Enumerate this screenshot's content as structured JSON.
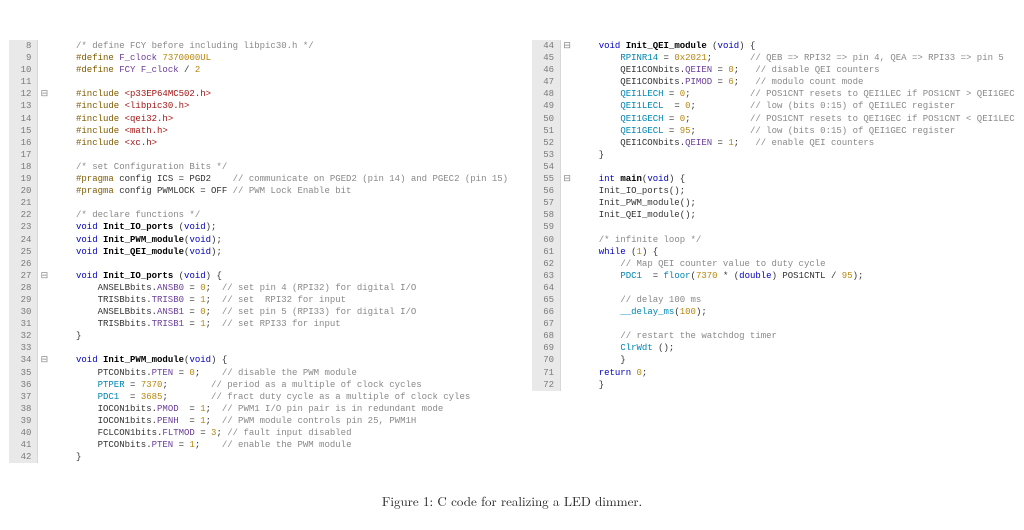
{
  "caption": "Figure 1: C code for realizing a LED dimmer.",
  "left": [
    {
      "n": 8,
      "fold": "",
      "tokens": [
        [
          "    ",
          ""
        ],
        [
          "/* define FCY before including libpic30.h */",
          "cm"
        ]
      ]
    },
    {
      "n": 9,
      "fold": "",
      "tokens": [
        [
          "    ",
          ""
        ],
        [
          "#define",
          "pp"
        ],
        [
          " ",
          ""
        ],
        [
          "F_clock",
          "mac"
        ],
        [
          " ",
          ""
        ],
        [
          "7370000UL",
          "num"
        ]
      ]
    },
    {
      "n": 10,
      "fold": "",
      "tokens": [
        [
          "    ",
          ""
        ],
        [
          "#define",
          "pp"
        ],
        [
          " ",
          ""
        ],
        [
          "FCY",
          "mac"
        ],
        [
          " ",
          ""
        ],
        [
          "F_clock",
          "mac"
        ],
        [
          " / ",
          ""
        ],
        [
          "2",
          "num"
        ]
      ]
    },
    {
      "n": 11,
      "fold": "",
      "tokens": []
    },
    {
      "n": 12,
      "fold": "⊟",
      "tokens": [
        [
          "    ",
          ""
        ],
        [
          "#include",
          "pp"
        ],
        [
          " ",
          ""
        ],
        [
          "<p33EP64MC502.h>",
          "str"
        ]
      ]
    },
    {
      "n": 13,
      "fold": "",
      "tokens": [
        [
          "    ",
          ""
        ],
        [
          "#include",
          "pp"
        ],
        [
          " ",
          ""
        ],
        [
          "<libpic30.h>",
          "str"
        ]
      ]
    },
    {
      "n": 14,
      "fold": "",
      "tokens": [
        [
          "    ",
          ""
        ],
        [
          "#include",
          "pp"
        ],
        [
          " ",
          ""
        ],
        [
          "<qei32.h>",
          "str"
        ]
      ]
    },
    {
      "n": 15,
      "fold": "",
      "tokens": [
        [
          "    ",
          ""
        ],
        [
          "#include",
          "pp"
        ],
        [
          " ",
          ""
        ],
        [
          "<math.h>",
          "str"
        ]
      ]
    },
    {
      "n": 16,
      "fold": "",
      "tokens": [
        [
          "    ",
          ""
        ],
        [
          "#include",
          "pp"
        ],
        [
          " ",
          ""
        ],
        [
          "<xc.h>",
          "str"
        ]
      ]
    },
    {
      "n": 17,
      "fold": "",
      "tokens": []
    },
    {
      "n": 18,
      "fold": "",
      "tokens": [
        [
          "    ",
          ""
        ],
        [
          "/* set Configuration Bits */",
          "cm"
        ]
      ]
    },
    {
      "n": 19,
      "fold": "",
      "tokens": [
        [
          "    ",
          ""
        ],
        [
          "#pragma",
          "pp"
        ],
        [
          " config ICS = PGD2    ",
          ""
        ],
        [
          "// communicate on PGED2 (pin 14) and PGEC2 (pin 15)",
          "cm"
        ]
      ]
    },
    {
      "n": 20,
      "fold": "",
      "tokens": [
        [
          "    ",
          ""
        ],
        [
          "#pragma",
          "pp"
        ],
        [
          " config PWMLOCK = OFF ",
          ""
        ],
        [
          "// PWM Lock Enable bit",
          "cm"
        ]
      ]
    },
    {
      "n": 21,
      "fold": "",
      "tokens": []
    },
    {
      "n": 22,
      "fold": "",
      "tokens": [
        [
          "    ",
          ""
        ],
        [
          "/* declare functions */",
          "cm"
        ]
      ]
    },
    {
      "n": 23,
      "fold": "",
      "tokens": [
        [
          "    ",
          ""
        ],
        [
          "void",
          "kw"
        ],
        [
          " ",
          ""
        ],
        [
          "Init_IO_ports",
          "fn"
        ],
        [
          " (",
          ""
        ],
        [
          "void",
          "kw"
        ],
        [
          ");",
          ""
        ]
      ]
    },
    {
      "n": 24,
      "fold": "",
      "tokens": [
        [
          "    ",
          ""
        ],
        [
          "void",
          "kw"
        ],
        [
          " ",
          ""
        ],
        [
          "Init_PWM_module",
          "fn"
        ],
        [
          "(",
          ""
        ],
        [
          "void",
          "kw"
        ],
        [
          ");",
          ""
        ]
      ]
    },
    {
      "n": 25,
      "fold": "",
      "tokens": [
        [
          "    ",
          ""
        ],
        [
          "void",
          "kw"
        ],
        [
          " ",
          ""
        ],
        [
          "Init_QEI_module",
          "fn"
        ],
        [
          "(",
          ""
        ],
        [
          "void",
          "kw"
        ],
        [
          ");",
          ""
        ]
      ]
    },
    {
      "n": 26,
      "fold": "",
      "tokens": []
    },
    {
      "n": 27,
      "fold": "⊟",
      "tokens": [
        [
          "    ",
          ""
        ],
        [
          "void",
          "kw"
        ],
        [
          " ",
          ""
        ],
        [
          "Init_IO_ports",
          "fn"
        ],
        [
          " (",
          ""
        ],
        [
          "void",
          "kw"
        ],
        [
          ") {",
          ""
        ]
      ]
    },
    {
      "n": 28,
      "fold": "",
      "tokens": [
        [
          "        ANSELBbits.",
          ""
        ],
        [
          "ANSB0",
          "fld"
        ],
        [
          " = ",
          ""
        ],
        [
          "0",
          "num"
        ],
        [
          ";  ",
          ""
        ],
        [
          "// set pin 4 (RPI32) for digital I/O",
          "cm"
        ]
      ]
    },
    {
      "n": 29,
      "fold": "",
      "tokens": [
        [
          "        TRISBbits.",
          ""
        ],
        [
          "TRISB0",
          "fld"
        ],
        [
          " = ",
          ""
        ],
        [
          "1",
          "num"
        ],
        [
          ";  ",
          ""
        ],
        [
          "// set  RPI32 for input",
          "cm"
        ]
      ]
    },
    {
      "n": 30,
      "fold": "",
      "tokens": [
        [
          "        ANSELBbits.",
          ""
        ],
        [
          "ANSB1",
          "fld"
        ],
        [
          " = ",
          ""
        ],
        [
          "0",
          "num"
        ],
        [
          ";  ",
          ""
        ],
        [
          "// set pin 5 (RPI33) for digital I/O",
          "cm"
        ]
      ]
    },
    {
      "n": 31,
      "fold": "",
      "tokens": [
        [
          "        TRISBbits.",
          ""
        ],
        [
          "TRISB1",
          "fld"
        ],
        [
          " = ",
          ""
        ],
        [
          "1",
          "num"
        ],
        [
          ";  ",
          ""
        ],
        [
          "// set RPI33 for input",
          "cm"
        ]
      ]
    },
    {
      "n": 32,
      "fold": "",
      "tokens": [
        [
          "    }",
          ""
        ]
      ]
    },
    {
      "n": 33,
      "fold": "",
      "tokens": []
    },
    {
      "n": 34,
      "fold": "⊟",
      "tokens": [
        [
          "    ",
          ""
        ],
        [
          "void",
          "kw"
        ],
        [
          " ",
          ""
        ],
        [
          "Init_PWM_module",
          "fn"
        ],
        [
          "(",
          ""
        ],
        [
          "void",
          "kw"
        ],
        [
          ") {",
          ""
        ]
      ]
    },
    {
      "n": 35,
      "fold": "",
      "tokens": [
        [
          "        PTCONbits.",
          ""
        ],
        [
          "PTEN",
          "fld"
        ],
        [
          " = ",
          ""
        ],
        [
          "0",
          "num"
        ],
        [
          ";    ",
          ""
        ],
        [
          "// disable the PWM module",
          "cm"
        ]
      ]
    },
    {
      "n": 36,
      "fold": "",
      "tokens": [
        [
          "        ",
          ""
        ],
        [
          "PTPER",
          "ref"
        ],
        [
          " = ",
          ""
        ],
        [
          "7370",
          "num"
        ],
        [
          ";        ",
          ""
        ],
        [
          "// period as a multiple of clock cycles",
          "cm"
        ]
      ]
    },
    {
      "n": 37,
      "fold": "",
      "tokens": [
        [
          "        ",
          ""
        ],
        [
          "PDC1",
          "ref"
        ],
        [
          "  = ",
          ""
        ],
        [
          "3685",
          "num"
        ],
        [
          ";        ",
          ""
        ],
        [
          "// fract duty cycle as a multiple of clock cyles",
          "cm"
        ]
      ]
    },
    {
      "n": 38,
      "fold": "",
      "tokens": [
        [
          "        IOCON1bits.",
          ""
        ],
        [
          "PMOD",
          "fld"
        ],
        [
          "  = ",
          ""
        ],
        [
          "1",
          "num"
        ],
        [
          ";  ",
          ""
        ],
        [
          "// PWM1 I/O pin pair is in redundant mode",
          "cm"
        ]
      ]
    },
    {
      "n": 39,
      "fold": "",
      "tokens": [
        [
          "        IOCON1bits.",
          ""
        ],
        [
          "PENH",
          "fld"
        ],
        [
          "  = ",
          ""
        ],
        [
          "1",
          "num"
        ],
        [
          ";  ",
          ""
        ],
        [
          "// PWM module controls pin 25, PWM1H",
          "cm"
        ]
      ]
    },
    {
      "n": 40,
      "fold": "",
      "tokens": [
        [
          "        FCLCON1bits.",
          ""
        ],
        [
          "FLTMOD",
          "fld"
        ],
        [
          " = ",
          ""
        ],
        [
          "3",
          "num"
        ],
        [
          "; ",
          ""
        ],
        [
          "// fault input disabled",
          "cm"
        ]
      ]
    },
    {
      "n": 41,
      "fold": "",
      "tokens": [
        [
          "        PTCONbits.",
          ""
        ],
        [
          "PTEN",
          "fld"
        ],
        [
          " = ",
          ""
        ],
        [
          "1",
          "num"
        ],
        [
          ";    ",
          ""
        ],
        [
          "// enable the PWM module",
          "cm"
        ]
      ]
    },
    {
      "n": 42,
      "fold": "",
      "tokens": [
        [
          "    }",
          ""
        ]
      ]
    }
  ],
  "right": [
    {
      "n": 44,
      "fold": "⊟",
      "tokens": [
        [
          "    ",
          ""
        ],
        [
          "void",
          "kw"
        ],
        [
          " ",
          ""
        ],
        [
          "Init_QEI_module",
          "fn"
        ],
        [
          " (",
          ""
        ],
        [
          "void",
          "kw"
        ],
        [
          ") {",
          ""
        ]
      ]
    },
    {
      "n": 45,
      "fold": "",
      "tokens": [
        [
          "        ",
          ""
        ],
        [
          "RPINR14",
          "ref"
        ],
        [
          " = ",
          ""
        ],
        [
          "0x2021",
          "num"
        ],
        [
          ";       ",
          ""
        ],
        [
          "// QEB => RPI32 => pin 4, QEA => RPI33 => pin 5",
          "cm"
        ]
      ]
    },
    {
      "n": 46,
      "fold": "",
      "tokens": [
        [
          "        QEI1CONbits.",
          ""
        ],
        [
          "QEIEN",
          "fld"
        ],
        [
          " = ",
          ""
        ],
        [
          "0",
          "num"
        ],
        [
          ";   ",
          ""
        ],
        [
          "// disable QEI counters",
          "cm"
        ]
      ]
    },
    {
      "n": 47,
      "fold": "",
      "tokens": [
        [
          "        QEI1CONbits.",
          ""
        ],
        [
          "PIMOD",
          "fld"
        ],
        [
          " = ",
          ""
        ],
        [
          "6",
          "num"
        ],
        [
          ";   ",
          ""
        ],
        [
          "// modulo count mode",
          "cm"
        ]
      ]
    },
    {
      "n": 48,
      "fold": "",
      "tokens": [
        [
          "        ",
          ""
        ],
        [
          "QEI1LECH",
          "ref"
        ],
        [
          " = ",
          ""
        ],
        [
          "0",
          "num"
        ],
        [
          ";           ",
          ""
        ],
        [
          "// POS1CNT resets to QEI1LEC if POS1CNT > QEI1GEC",
          "cm"
        ]
      ]
    },
    {
      "n": 49,
      "fold": "",
      "tokens": [
        [
          "        ",
          ""
        ],
        [
          "QEI1LECL",
          "ref"
        ],
        [
          "  = ",
          ""
        ],
        [
          "0",
          "num"
        ],
        [
          ";          ",
          ""
        ],
        [
          "// low (bits 0:15) of QEI1LEC register",
          "cm"
        ]
      ]
    },
    {
      "n": 50,
      "fold": "",
      "tokens": [
        [
          "        ",
          ""
        ],
        [
          "QEI1GECH",
          "ref"
        ],
        [
          " = ",
          ""
        ],
        [
          "0",
          "num"
        ],
        [
          ";           ",
          ""
        ],
        [
          "// POS1CNT resets to QEI1GEC if POS1CNT < QEI1LEC",
          "cm"
        ]
      ]
    },
    {
      "n": 51,
      "fold": "",
      "tokens": [
        [
          "        ",
          ""
        ],
        [
          "QEI1GECL",
          "ref"
        ],
        [
          " = ",
          ""
        ],
        [
          "95",
          "num"
        ],
        [
          ";          ",
          ""
        ],
        [
          "// low (bits 0:15) of QEI1GEC register",
          "cm"
        ]
      ]
    },
    {
      "n": 52,
      "fold": "",
      "tokens": [
        [
          "        QEI1CONbits.",
          ""
        ],
        [
          "QEIEN",
          "fld"
        ],
        [
          " = ",
          ""
        ],
        [
          "1",
          "num"
        ],
        [
          ";   ",
          ""
        ],
        [
          "// enable QEI counters",
          "cm"
        ]
      ]
    },
    {
      "n": 53,
      "fold": "",
      "tokens": [
        [
          "    }",
          ""
        ]
      ]
    },
    {
      "n": 54,
      "fold": "",
      "tokens": []
    },
    {
      "n": 55,
      "fold": "⊟",
      "tokens": [
        [
          "    ",
          ""
        ],
        [
          "int",
          "kw"
        ],
        [
          " ",
          ""
        ],
        [
          "main",
          "fn"
        ],
        [
          "(",
          ""
        ],
        [
          "void",
          "kw"
        ],
        [
          ") {",
          ""
        ]
      ]
    },
    {
      "n": 56,
      "fold": "",
      "tokens": [
        [
          "    Init_IO_ports();",
          ""
        ]
      ]
    },
    {
      "n": 57,
      "fold": "",
      "tokens": [
        [
          "    Init_PWM_module();",
          ""
        ]
      ]
    },
    {
      "n": 58,
      "fold": "",
      "tokens": [
        [
          "    Init_QEI_module();",
          ""
        ]
      ]
    },
    {
      "n": 59,
      "fold": "",
      "tokens": []
    },
    {
      "n": 60,
      "fold": "",
      "tokens": [
        [
          "    ",
          ""
        ],
        [
          "/* infinite loop */",
          "cm"
        ]
      ]
    },
    {
      "n": 61,
      "fold": "",
      "tokens": [
        [
          "    ",
          ""
        ],
        [
          "while",
          "kw"
        ],
        [
          " (",
          ""
        ],
        [
          "1",
          "num"
        ],
        [
          ") {",
          ""
        ]
      ]
    },
    {
      "n": 62,
      "fold": "",
      "tokens": [
        [
          "        ",
          ""
        ],
        [
          "// Map QEI counter value to duty cycle",
          "cm"
        ]
      ]
    },
    {
      "n": 63,
      "fold": "",
      "tokens": [
        [
          "        ",
          ""
        ],
        [
          "PDC1",
          "ref"
        ],
        [
          "  = ",
          ""
        ],
        [
          "floor",
          "ref"
        ],
        [
          "(",
          ""
        ],
        [
          "7370",
          "num"
        ],
        [
          " * (",
          ""
        ],
        [
          "double",
          "kw"
        ],
        [
          ") POS1CNTL / ",
          ""
        ],
        [
          "95",
          "num"
        ],
        [
          ");",
          ""
        ]
      ]
    },
    {
      "n": 64,
      "fold": "",
      "tokens": []
    },
    {
      "n": 65,
      "fold": "",
      "tokens": [
        [
          "        ",
          ""
        ],
        [
          "// delay 100 ms",
          "cm"
        ]
      ]
    },
    {
      "n": 66,
      "fold": "",
      "tokens": [
        [
          "        ",
          ""
        ],
        [
          "__delay_ms",
          "ref"
        ],
        [
          "(",
          ""
        ],
        [
          "100",
          "num"
        ],
        [
          ");",
          ""
        ]
      ]
    },
    {
      "n": 67,
      "fold": "",
      "tokens": []
    },
    {
      "n": 68,
      "fold": "",
      "tokens": [
        [
          "        ",
          ""
        ],
        [
          "// restart the watchdog timer",
          "cm"
        ]
      ]
    },
    {
      "n": 69,
      "fold": "",
      "tokens": [
        [
          "        ",
          ""
        ],
        [
          "ClrWdt",
          "ref"
        ],
        [
          " ();",
          ""
        ]
      ]
    },
    {
      "n": 70,
      "fold": "",
      "tokens": [
        [
          "        }",
          ""
        ]
      ]
    },
    {
      "n": 71,
      "fold": "",
      "tokens": [
        [
          "    ",
          ""
        ],
        [
          "return",
          "kw"
        ],
        [
          " ",
          ""
        ],
        [
          "0",
          "num"
        ],
        [
          ";",
          ""
        ]
      ]
    },
    {
      "n": 72,
      "fold": "",
      "tokens": [
        [
          "    }",
          ""
        ]
      ]
    }
  ]
}
